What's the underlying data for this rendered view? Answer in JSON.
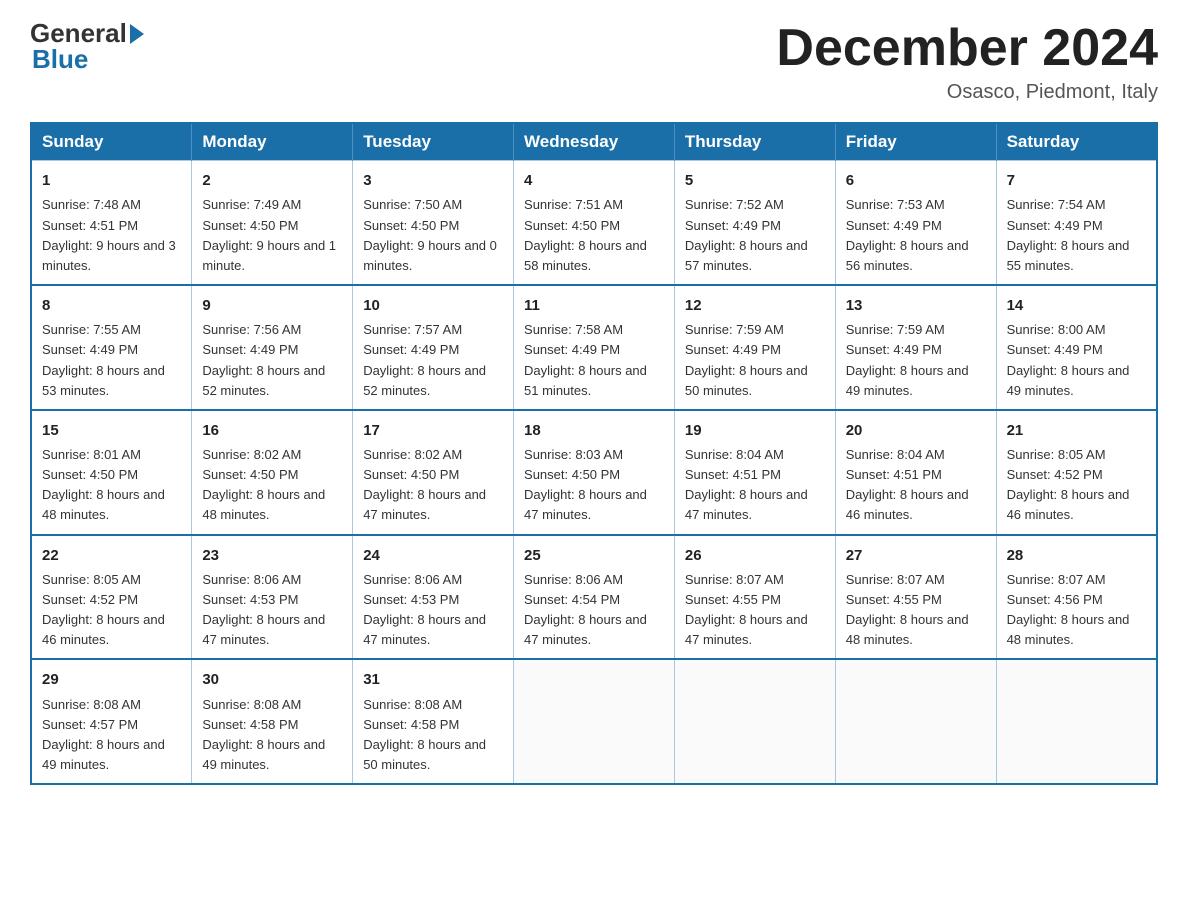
{
  "header": {
    "logo_general": "General",
    "logo_blue": "Blue",
    "month_title": "December 2024",
    "location": "Osasco, Piedmont, Italy"
  },
  "weekdays": [
    "Sunday",
    "Monday",
    "Tuesday",
    "Wednesday",
    "Thursday",
    "Friday",
    "Saturday"
  ],
  "weeks": [
    [
      {
        "day": "1",
        "sunrise": "7:48 AM",
        "sunset": "4:51 PM",
        "daylight": "9 hours and 3 minutes."
      },
      {
        "day": "2",
        "sunrise": "7:49 AM",
        "sunset": "4:50 PM",
        "daylight": "9 hours and 1 minute."
      },
      {
        "day": "3",
        "sunrise": "7:50 AM",
        "sunset": "4:50 PM",
        "daylight": "9 hours and 0 minutes."
      },
      {
        "day": "4",
        "sunrise": "7:51 AM",
        "sunset": "4:50 PM",
        "daylight": "8 hours and 58 minutes."
      },
      {
        "day": "5",
        "sunrise": "7:52 AM",
        "sunset": "4:49 PM",
        "daylight": "8 hours and 57 minutes."
      },
      {
        "day": "6",
        "sunrise": "7:53 AM",
        "sunset": "4:49 PM",
        "daylight": "8 hours and 56 minutes."
      },
      {
        "day": "7",
        "sunrise": "7:54 AM",
        "sunset": "4:49 PM",
        "daylight": "8 hours and 55 minutes."
      }
    ],
    [
      {
        "day": "8",
        "sunrise": "7:55 AM",
        "sunset": "4:49 PM",
        "daylight": "8 hours and 53 minutes."
      },
      {
        "day": "9",
        "sunrise": "7:56 AM",
        "sunset": "4:49 PM",
        "daylight": "8 hours and 52 minutes."
      },
      {
        "day": "10",
        "sunrise": "7:57 AM",
        "sunset": "4:49 PM",
        "daylight": "8 hours and 52 minutes."
      },
      {
        "day": "11",
        "sunrise": "7:58 AM",
        "sunset": "4:49 PM",
        "daylight": "8 hours and 51 minutes."
      },
      {
        "day": "12",
        "sunrise": "7:59 AM",
        "sunset": "4:49 PM",
        "daylight": "8 hours and 50 minutes."
      },
      {
        "day": "13",
        "sunrise": "7:59 AM",
        "sunset": "4:49 PM",
        "daylight": "8 hours and 49 minutes."
      },
      {
        "day": "14",
        "sunrise": "8:00 AM",
        "sunset": "4:49 PM",
        "daylight": "8 hours and 49 minutes."
      }
    ],
    [
      {
        "day": "15",
        "sunrise": "8:01 AM",
        "sunset": "4:50 PM",
        "daylight": "8 hours and 48 minutes."
      },
      {
        "day": "16",
        "sunrise": "8:02 AM",
        "sunset": "4:50 PM",
        "daylight": "8 hours and 48 minutes."
      },
      {
        "day": "17",
        "sunrise": "8:02 AM",
        "sunset": "4:50 PM",
        "daylight": "8 hours and 47 minutes."
      },
      {
        "day": "18",
        "sunrise": "8:03 AM",
        "sunset": "4:50 PM",
        "daylight": "8 hours and 47 minutes."
      },
      {
        "day": "19",
        "sunrise": "8:04 AM",
        "sunset": "4:51 PM",
        "daylight": "8 hours and 47 minutes."
      },
      {
        "day": "20",
        "sunrise": "8:04 AM",
        "sunset": "4:51 PM",
        "daylight": "8 hours and 46 minutes."
      },
      {
        "day": "21",
        "sunrise": "8:05 AM",
        "sunset": "4:52 PM",
        "daylight": "8 hours and 46 minutes."
      }
    ],
    [
      {
        "day": "22",
        "sunrise": "8:05 AM",
        "sunset": "4:52 PM",
        "daylight": "8 hours and 46 minutes."
      },
      {
        "day": "23",
        "sunrise": "8:06 AM",
        "sunset": "4:53 PM",
        "daylight": "8 hours and 47 minutes."
      },
      {
        "day": "24",
        "sunrise": "8:06 AM",
        "sunset": "4:53 PM",
        "daylight": "8 hours and 47 minutes."
      },
      {
        "day": "25",
        "sunrise": "8:06 AM",
        "sunset": "4:54 PM",
        "daylight": "8 hours and 47 minutes."
      },
      {
        "day": "26",
        "sunrise": "8:07 AM",
        "sunset": "4:55 PM",
        "daylight": "8 hours and 47 minutes."
      },
      {
        "day": "27",
        "sunrise": "8:07 AM",
        "sunset": "4:55 PM",
        "daylight": "8 hours and 48 minutes."
      },
      {
        "day": "28",
        "sunrise": "8:07 AM",
        "sunset": "4:56 PM",
        "daylight": "8 hours and 48 minutes."
      }
    ],
    [
      {
        "day": "29",
        "sunrise": "8:08 AM",
        "sunset": "4:57 PM",
        "daylight": "8 hours and 49 minutes."
      },
      {
        "day": "30",
        "sunrise": "8:08 AM",
        "sunset": "4:58 PM",
        "daylight": "8 hours and 49 minutes."
      },
      {
        "day": "31",
        "sunrise": "8:08 AM",
        "sunset": "4:58 PM",
        "daylight": "8 hours and 50 minutes."
      },
      null,
      null,
      null,
      null
    ]
  ],
  "labels": {
    "sunrise": "Sunrise:",
    "sunset": "Sunset:",
    "daylight": "Daylight:"
  }
}
